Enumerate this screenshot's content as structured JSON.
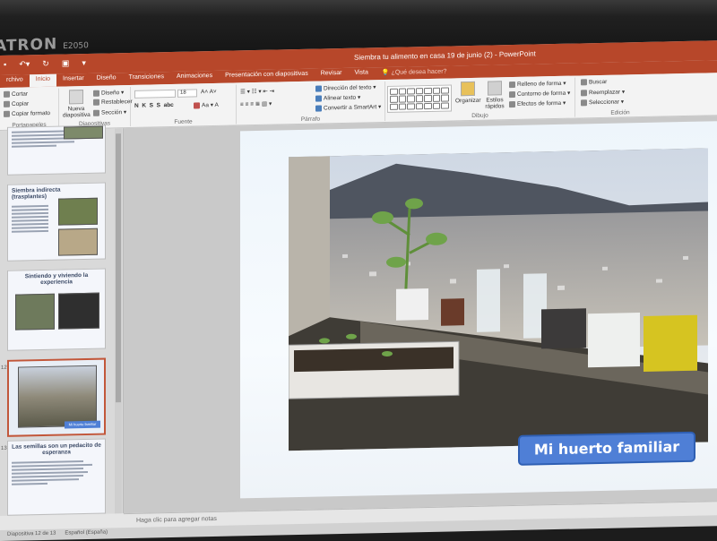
{
  "monitor": {
    "brand": "ATRON",
    "model": "E2050"
  },
  "window": {
    "title": "Siembra tu alimento en casa 19 de junio (2) - PowerPoint"
  },
  "tabs": [
    "rchivo",
    "Inicio",
    "Insertar",
    "Diseño",
    "Transiciones",
    "Animaciones",
    "Presentación con diapositivas",
    "Revisar",
    "Vista"
  ],
  "tell_me": "¿Qué desea hacer?",
  "ribbon": {
    "clipboard": {
      "cut": "Cortar",
      "copy": "Copiar",
      "format_painter": "Copiar formato",
      "label": "Portapapeles"
    },
    "slides": {
      "new_slide": "Nueva diapositiva",
      "layout": "Diseño",
      "reset": "Restablecer",
      "section": "Sección",
      "label": "Diapositivas"
    },
    "font": {
      "label": "Fuente",
      "bold": "N",
      "italic": "K",
      "underline": "S",
      "strike": "S",
      "abc": "abc",
      "font_size": "18"
    },
    "paragraph": {
      "text_direction": "Dirección del texto",
      "align_text": "Alinear texto",
      "smartart": "Convertir a SmartArt",
      "label": "Párrafo"
    },
    "drawing": {
      "arrange": "Organizar",
      "quick_styles": "Estilos rápidos",
      "fill": "Relleno de forma",
      "outline": "Contorno de forma",
      "effects": "Efectos de forma",
      "label": "Dibujo"
    },
    "editing": {
      "find": "Buscar",
      "replace": "Reemplazar",
      "select": "Seleccionar",
      "label": "Edición"
    }
  },
  "thumbnails": [
    {
      "num": "",
      "title": "",
      "lines": 5
    },
    {
      "num": "",
      "title": "Siembra indirecta (trasplantes)",
      "lines": 8
    },
    {
      "num": "",
      "title": "Sintiendo y viviendo la experiencia",
      "lines": 0
    },
    {
      "num": "12",
      "title": "",
      "caption": "Mi huerto familiar",
      "lines": 0
    },
    {
      "num": "13",
      "title": "Las semillas son un pedacito de esperanza",
      "lines": 7
    }
  ],
  "slide": {
    "caption": "Mi huerto familiar"
  },
  "notes_placeholder": "Haga clic para agregar notas",
  "status": {
    "slide_info": "Diapositiva 12 de 13",
    "language": "Español (España)"
  }
}
